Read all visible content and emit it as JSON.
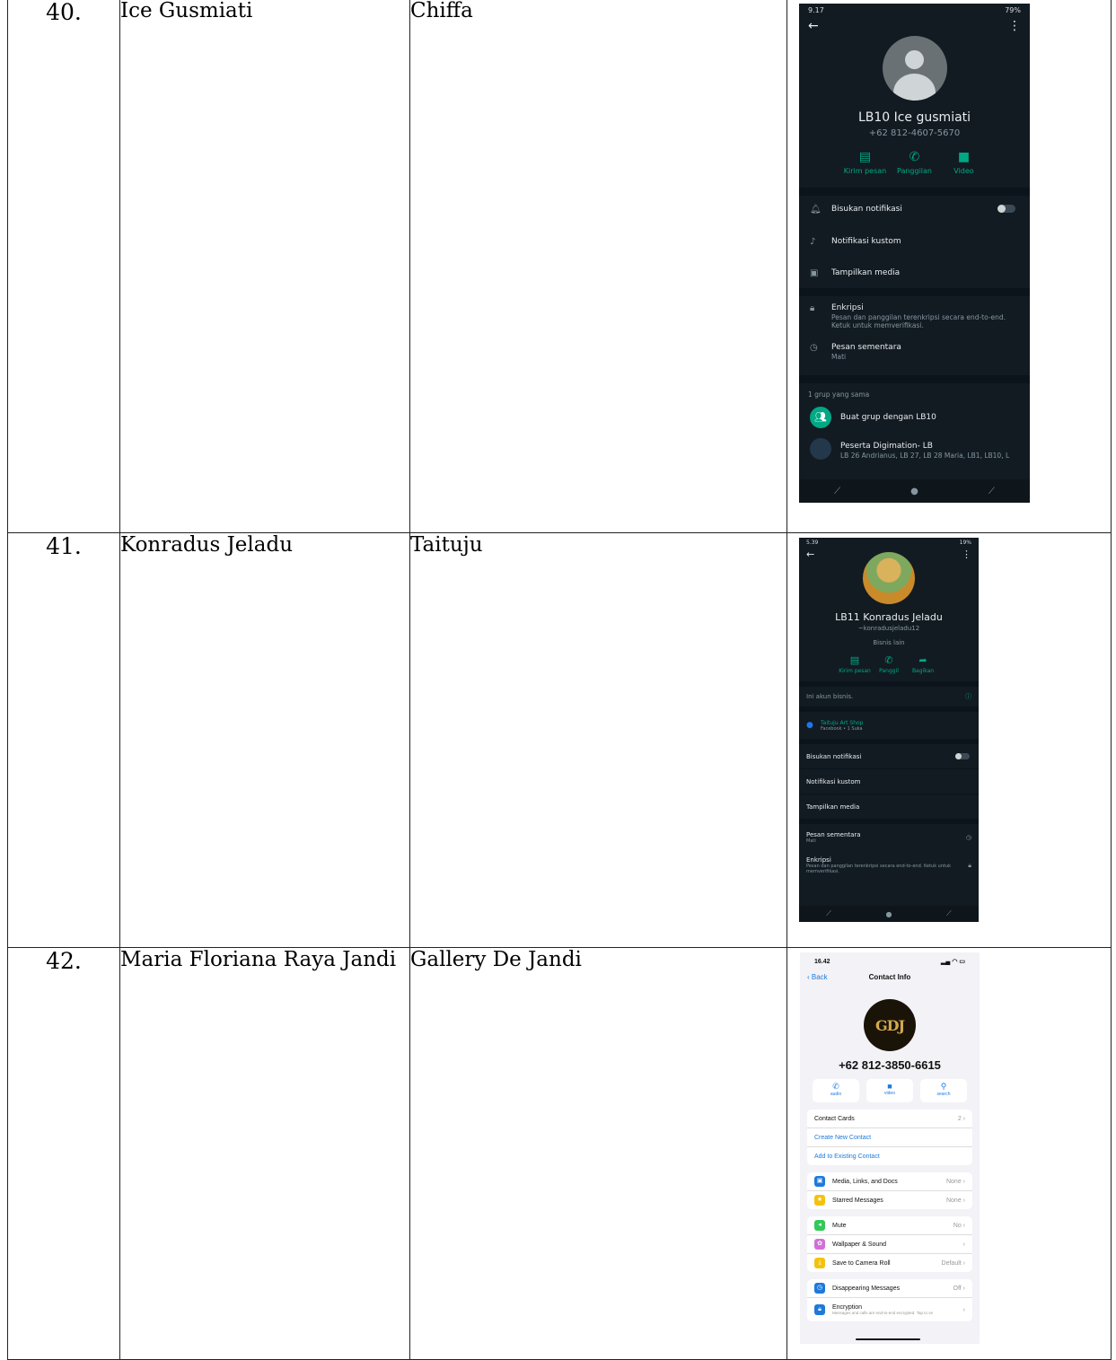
{
  "rows": [
    {
      "no": "40.",
      "name": "Ice Gusmiati",
      "business": "Chiffa",
      "screen": {
        "status_time": "9.17",
        "status_right": "79%",
        "contact_name": "LB10 Ice gusmiati",
        "phone": "+62 812-4607-5670",
        "actions": [
          {
            "icon": "message-icon",
            "glyph": "▤",
            "label": "Kirim pesan"
          },
          {
            "icon": "phone-icon",
            "glyph": "✆",
            "label": "Panggilan"
          },
          {
            "icon": "video-icon",
            "glyph": "■",
            "label": "Video"
          }
        ],
        "mute": "Bisukan notifikasi",
        "custom_notif": "Notifikasi kustom",
        "media": "Tampilkan media",
        "encryption": "Enkripsi",
        "encryption_sub": "Pesan dan panggilan terenkripsi secara end-to-end. Ketuk untuk memverifikasi.",
        "disappearing": "Pesan sementara",
        "disappearing_sub": "Mati",
        "groups_header": "1 grup yang sama",
        "create_group": "Buat grup dengan LB10",
        "group_name": "Peserta Digimation- LB",
        "group_members": "LB 26 Andrianus, LB 27, LB 28 Maria, LB1, LB10, L"
      }
    },
    {
      "no": "41.",
      "name": "Konradus Jeladu",
      "business": "Taituju",
      "screen": {
        "status_time": "5.39",
        "status_right": "19%",
        "contact_name": "LB11 Konradus Jeladu",
        "username": "~konradusjeladu12",
        "category": "Bisnis lain",
        "actions": [
          {
            "icon": "message-icon",
            "glyph": "▤",
            "label": "Kirim pesan"
          },
          {
            "icon": "phone-icon",
            "glyph": "✆",
            "label": "Panggil"
          },
          {
            "icon": "share-icon",
            "glyph": "➦",
            "label": "Bagikan"
          }
        ],
        "business_note": "Ini akun bisnis.",
        "fb_page": "Taituju Art Shop",
        "fb_sub": "Facebook • 1 Suka",
        "mute": "Bisukan notifikasi",
        "custom_notif": "Notifikasi kustom",
        "media": "Tampilkan media",
        "disappearing": "Pesan sementara",
        "disappearing_sub": "Mati",
        "encryption": "Enkripsi",
        "encryption_sub": "Pesan dan panggilan terenkripsi secara end-to-end. Ketuk untuk memverifikasi."
      }
    },
    {
      "no": "42.",
      "name": "Maria Floriana Raya Jandi",
      "business": "Gallery De Jandi",
      "screen": {
        "status_time": "16.42",
        "back": "Back",
        "title": "Contact Info",
        "logo_text": "GDJ",
        "phone": "+62 812-3850-6615",
        "buttons": [
          {
            "icon": "phone-icon",
            "glyph": "✆",
            "label": "audio"
          },
          {
            "icon": "video-icon",
            "glyph": "■",
            "label": "video"
          },
          {
            "icon": "search-icon",
            "glyph": "⚲",
            "label": "search"
          }
        ],
        "contact_cards": "Contact Cards",
        "contact_cards_value": "2",
        "create_contact": "Create New Contact",
        "add_existing": "Add to Existing Contact",
        "media_docs": "Media, Links, and Docs",
        "media_docs_value": "None",
        "starred": "Starred Messages",
        "starred_value": "None",
        "mute": "Mute",
        "mute_value": "No",
        "wallpaper": "Wallpaper & Sound",
        "save_camera": "Save to Camera Roll",
        "save_camera_value": "Default",
        "disappearing": "Disappearing Messages",
        "disappearing_value": "Off",
        "encryption": "Encryption",
        "encryption_sub": "Messages and calls are end-to-end encrypted. Tap to ve",
        "colors": {
          "blue": "#1e7ad9",
          "yellow": "#f4c20d",
          "green": "#34c759",
          "pink": "#d070d8"
        }
      }
    }
  ]
}
